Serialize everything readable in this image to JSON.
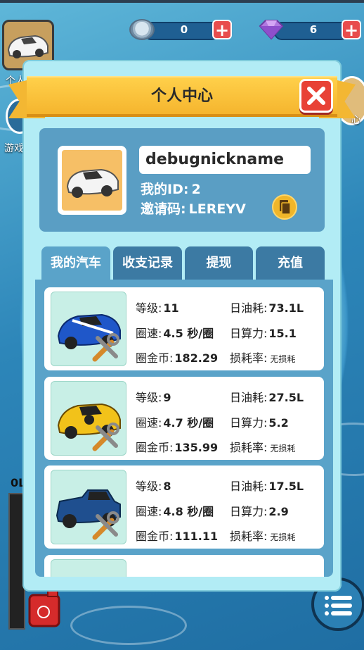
{
  "resources": {
    "coins": "0",
    "gems": "6",
    "plus": "+"
  },
  "side": {
    "left_label_1": "个人",
    "left_label_2": "游戏",
    "right_label": "心",
    "gauge_label": "0L"
  },
  "panel": {
    "title": "个人中心",
    "close_label": "✕"
  },
  "profile": {
    "nickname": "debugnickname",
    "id_label": "我的ID:",
    "id_value": "2",
    "invite_label": "邀请码:",
    "invite_value": "LEREYV"
  },
  "tabs": [
    "我的汽车",
    "收支记录",
    "提现",
    "充值"
  ],
  "labels": {
    "level": "等级:",
    "daily_fuel": "日油耗:",
    "lap_speed": "圈速:",
    "daily_power": "日算力:",
    "lap_coins": "圈金币:",
    "wear_rate": "损耗率:"
  },
  "cars": [
    {
      "color": "#1f57c9",
      "level": "11",
      "daily_fuel": "73.1L",
      "lap_speed": "4.5 秒/圈",
      "daily_power": "15.1",
      "lap_coins": "182.29",
      "wear_rate": "无损耗"
    },
    {
      "color": "#f2c21a",
      "level": "9",
      "daily_fuel": "27.5L",
      "lap_speed": "4.7 秒/圈",
      "daily_power": "5.2",
      "lap_coins": "135.99",
      "wear_rate": "无损耗"
    },
    {
      "color": "#1f4f8f",
      "level": "8",
      "daily_fuel": "17.5L",
      "lap_speed": "4.8 秒/圈",
      "daily_power": "2.9",
      "lap_coins": "111.11",
      "wear_rate": "无损耗"
    },
    {
      "color": "#2a8f4f",
      "level": "",
      "daily_fuel": "",
      "lap_speed": "",
      "daily_power": "",
      "lap_coins": "",
      "wear_rate": ""
    }
  ]
}
